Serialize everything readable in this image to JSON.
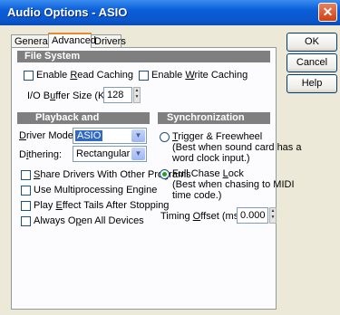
{
  "window": {
    "title": "Audio Options - ASIO"
  },
  "tabs": [
    {
      "label": "General"
    },
    {
      "label": "Advanced"
    },
    {
      "label": "Drivers"
    }
  ],
  "file_system": {
    "header": "File System",
    "read_caching": {
      "pre": "Enable ",
      "key": "R",
      "post": "ead Caching",
      "checked": false
    },
    "write_caching": {
      "pre": "Enable ",
      "key": "W",
      "post": "rite Caching",
      "checked": false
    },
    "buffer": {
      "pre": "I/O B",
      "key": "u",
      "post": "ffer Size (KB):",
      "value": "128"
    }
  },
  "playback": {
    "header": "Playback and Recording",
    "driver_mode": {
      "key": "D",
      "post": "river Mode:",
      "value": "ASIO"
    },
    "dithering": {
      "pre": "D",
      "key": "i",
      "post": "thering:",
      "value": "Rectangular"
    },
    "options": [
      {
        "pre": "",
        "key": "S",
        "post": "hare Drivers With Other Programs",
        "checked": false
      },
      {
        "pre": "Use Multiprocessing Engine",
        "key": "",
        "post": "",
        "checked": false
      },
      {
        "pre": "Play ",
        "key": "E",
        "post": "ffect Tails After Stopping",
        "checked": false
      },
      {
        "pre": "Always O",
        "key": "p",
        "post": "en All Devices",
        "checked": false
      }
    ]
  },
  "sync": {
    "header": "Synchronization",
    "trigger": {
      "key": "T",
      "post": "rigger & Freewheel",
      "desc1": "(Best when sound card has a",
      "desc2": "word clock input.)",
      "selected": false
    },
    "chase": {
      "pre": "Full Chase ",
      "key": "L",
      "post": "ock",
      "desc1": "(Best when chasing to MIDI",
      "desc2": "time code.)",
      "selected": true
    },
    "timing": {
      "pre": "Timing ",
      "key": "O",
      "post": "ffset (msec):",
      "value": "0.000"
    }
  },
  "buttons": {
    "ok": "OK",
    "cancel": "Cancel",
    "help": "Help"
  }
}
